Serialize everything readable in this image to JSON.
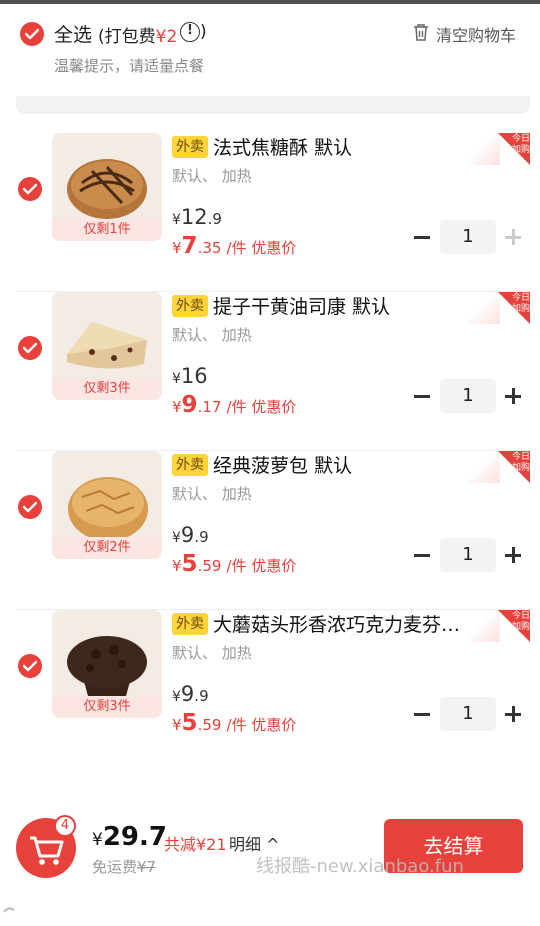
{
  "header": {
    "select_all_label": "全选",
    "packing_fee_prefix": "(打包费",
    "packing_fee_value": "¥2",
    "packing_fee_suffix": ")",
    "clear_cart_label": "清空购物车",
    "tip_text": "温馨提示，请适量点餐"
  },
  "colors": {
    "accent": "#e8403a",
    "tag_yellow": "#ffd43b"
  },
  "items": [
    {
      "tag": "外卖",
      "name": "法式焦糖酥 默认",
      "spec": "默认、 加热",
      "stock": "仅剩1件",
      "orig_int": "12",
      "orig_dec": ".9",
      "deal_int": "7",
      "deal_dec": ".35",
      "deal_unit": "/件 优惠价",
      "qty": "1",
      "badge_line1": "今日",
      "badge_line2": "加购",
      "plus_enabled": false
    },
    {
      "tag": "外卖",
      "name": "提子干黄油司康 默认",
      "spec": "默认、 加热",
      "stock": "仅剩3件",
      "orig_int": "16",
      "orig_dec": "",
      "deal_int": "9",
      "deal_dec": ".17",
      "deal_unit": "/件 优惠价",
      "qty": "1",
      "badge_line1": "今日",
      "badge_line2": "加购",
      "plus_enabled": true
    },
    {
      "tag": "外卖",
      "name": "经典菠萝包 默认",
      "spec": "默认、 加热",
      "stock": "仅剩2件",
      "orig_int": "9",
      "orig_dec": ".9",
      "deal_int": "5",
      "deal_dec": ".59",
      "deal_unit": "/件 优惠价",
      "qty": "1",
      "badge_line1": "今日",
      "badge_line2": "加购",
      "plus_enabled": true
    },
    {
      "tag": "外卖",
      "name": "大蘑菇头形香浓巧克力麦芬…",
      "spec": "默认、 加热",
      "stock": "仅剩3件",
      "orig_int": "9",
      "orig_dec": ".9",
      "deal_int": "5",
      "deal_dec": ".59",
      "deal_unit": "/件 优惠价",
      "qty": "1",
      "badge_line1": "今日",
      "badge_line2": "加购",
      "plus_enabled": true
    }
  ],
  "footer": {
    "cart_count": "4",
    "total_int": "29.7",
    "discount_text": "共减¥21",
    "detail_label": "明细 ^",
    "delivery_label": "免运费",
    "delivery_orig": "¥7",
    "checkout_label": "去结算",
    "watermark": "线报酷-new.xianbao.fun"
  },
  "currency": "¥"
}
